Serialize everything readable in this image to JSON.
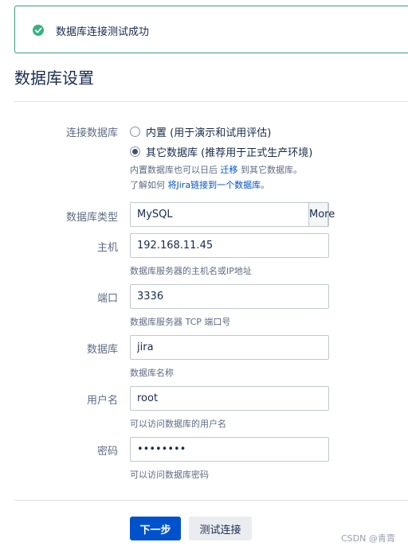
{
  "banner": {
    "message": "数据库连接测试成功",
    "icon": "success-check-icon",
    "color": "#36b37e"
  },
  "page_title": "数据库设置",
  "connection": {
    "label": "连接数据库",
    "options": [
      {
        "label": "内置 (用于演示和试用评估)",
        "checked": false
      },
      {
        "label": "其它数据库 (推荐用于正式生产环境)",
        "checked": true
      }
    ],
    "hint1_prefix": "内置数据库也可以日后 ",
    "hint1_link": "迁移",
    "hint1_suffix": " 到其它数据库。",
    "hint2_prefix": "了解如何 ",
    "hint2_link": "将Jira链接到一个数据库",
    "hint2_suffix": "。"
  },
  "db_type": {
    "label": "数据库类型",
    "value": "MySQL",
    "more_label": "More"
  },
  "host": {
    "label": "主机",
    "value": "192.168.11.45",
    "hint": "数据库服务器的主机名或IP地址"
  },
  "port": {
    "label": "端口",
    "value": "3336",
    "hint": "数据库服务器 TCP 端口号"
  },
  "database": {
    "label": "数据库",
    "value": "jira",
    "hint": "数据库名称"
  },
  "username": {
    "label": "用户名",
    "value": "root",
    "hint": "可以访问数据库的用户名"
  },
  "password": {
    "label": "密码",
    "value": "••••••••",
    "hint": "可以访问数据库密码"
  },
  "actions": {
    "next_label": "下一步",
    "test_label": "测试连接"
  },
  "watermark": "CSDN @青霄",
  "colors": {
    "primary": "#0052cc",
    "success": "#36b37e",
    "link": "#0052cc"
  }
}
